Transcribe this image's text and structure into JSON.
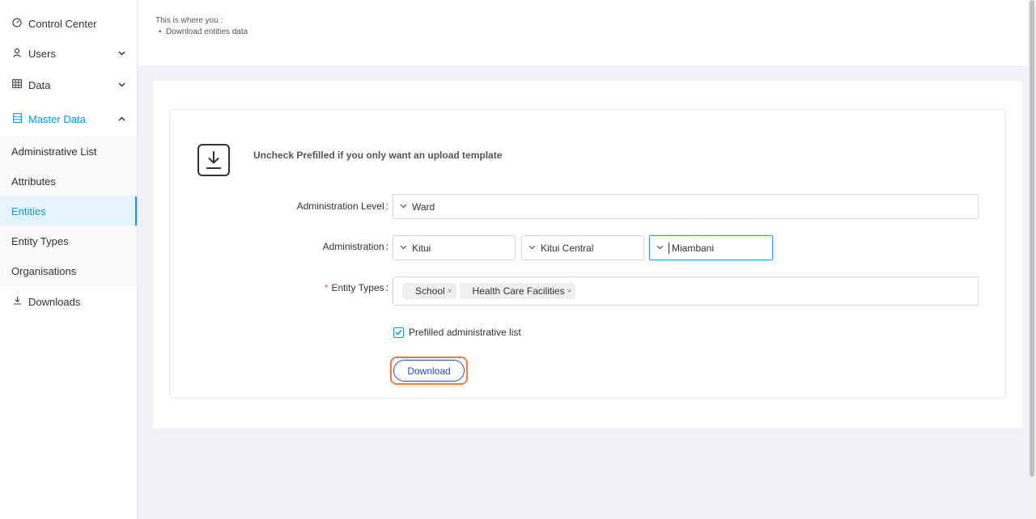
{
  "sidebar": {
    "items": [
      {
        "label": "Control Center",
        "icon": "dashboard-icon"
      },
      {
        "label": "Users",
        "icon": "user-icon"
      },
      {
        "label": "Data",
        "icon": "table-icon"
      },
      {
        "label": "Master Data",
        "icon": "database-icon"
      }
    ],
    "sub_items": [
      {
        "label": "Administrative List"
      },
      {
        "label": "Attributes"
      },
      {
        "label": "Entities"
      },
      {
        "label": "Entity Types"
      },
      {
        "label": "Organisations"
      }
    ],
    "downloads": {
      "label": "Downloads",
      "icon": "download-icon"
    }
  },
  "description": {
    "intro": "This is where you :",
    "bullets": [
      "Download entities data"
    ]
  },
  "form": {
    "hint": "Uncheck Prefilled if you only want an upload template",
    "admin_level_label": "Administration Level",
    "admin_level_value": "Ward",
    "administration_label": "Administration",
    "administration_values": [
      "Kitui",
      "Kitui Central",
      "Miambani"
    ],
    "entity_types_label": "Entity Types",
    "entity_types": [
      "School",
      "Health Care Facilities"
    ],
    "prefilled_label": "Prefilled administrative list",
    "download_label": "Download"
  },
  "colors": {
    "accent": "#1890ff",
    "button": "#1d4ed8",
    "highlight": "#f07a4a",
    "required": "#ff4d4f"
  }
}
